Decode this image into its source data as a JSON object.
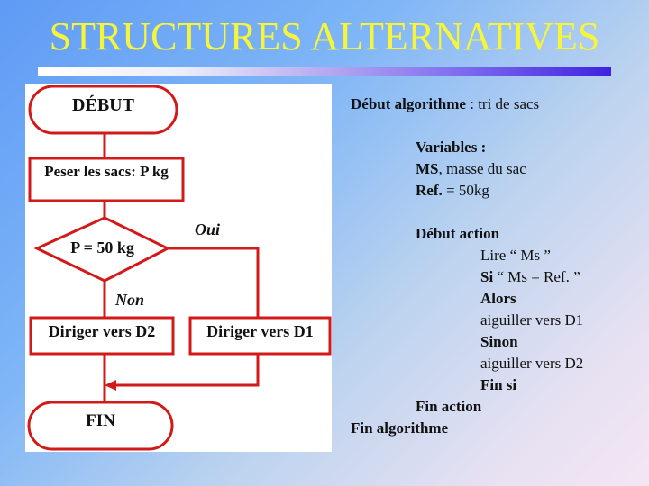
{
  "slide": {
    "title": "STRUCTURES ALTERNATIVES",
    "colors": {
      "title": "#f7f53a",
      "flowchart_stroke": "#d21a1a",
      "text": "#111111"
    }
  },
  "flowchart": {
    "start": "DÉBUT",
    "process": "Peser les sacs: P kg",
    "decision": "P = 50 kg",
    "yes_label": "Oui",
    "no_label": "Non",
    "branch_no": "Diriger vers D2",
    "branch_yes": "Diriger vers D1",
    "end": "FIN"
  },
  "algorithm": {
    "header_bold": "Début algorithme",
    "header_rest": " : tri de sacs",
    "variables_label": "Variables :",
    "var1_bold": "MS",
    "var1_rest": ", masse du sac",
    "var2_bold": "Ref.",
    "var2_rest": " = 50kg",
    "action_start": "Début action",
    "read": "Lire “  Ms  ”",
    "if_bold": "Si",
    "if_rest": " “  Ms = Ref.  ”",
    "then": "Alors",
    "then_action": "aiguiller vers D1",
    "else": "Sinon",
    "else_action": "aiguiller vers D2",
    "endif": "Fin si",
    "action_end": "Fin action",
    "end": "Fin algorithme"
  }
}
